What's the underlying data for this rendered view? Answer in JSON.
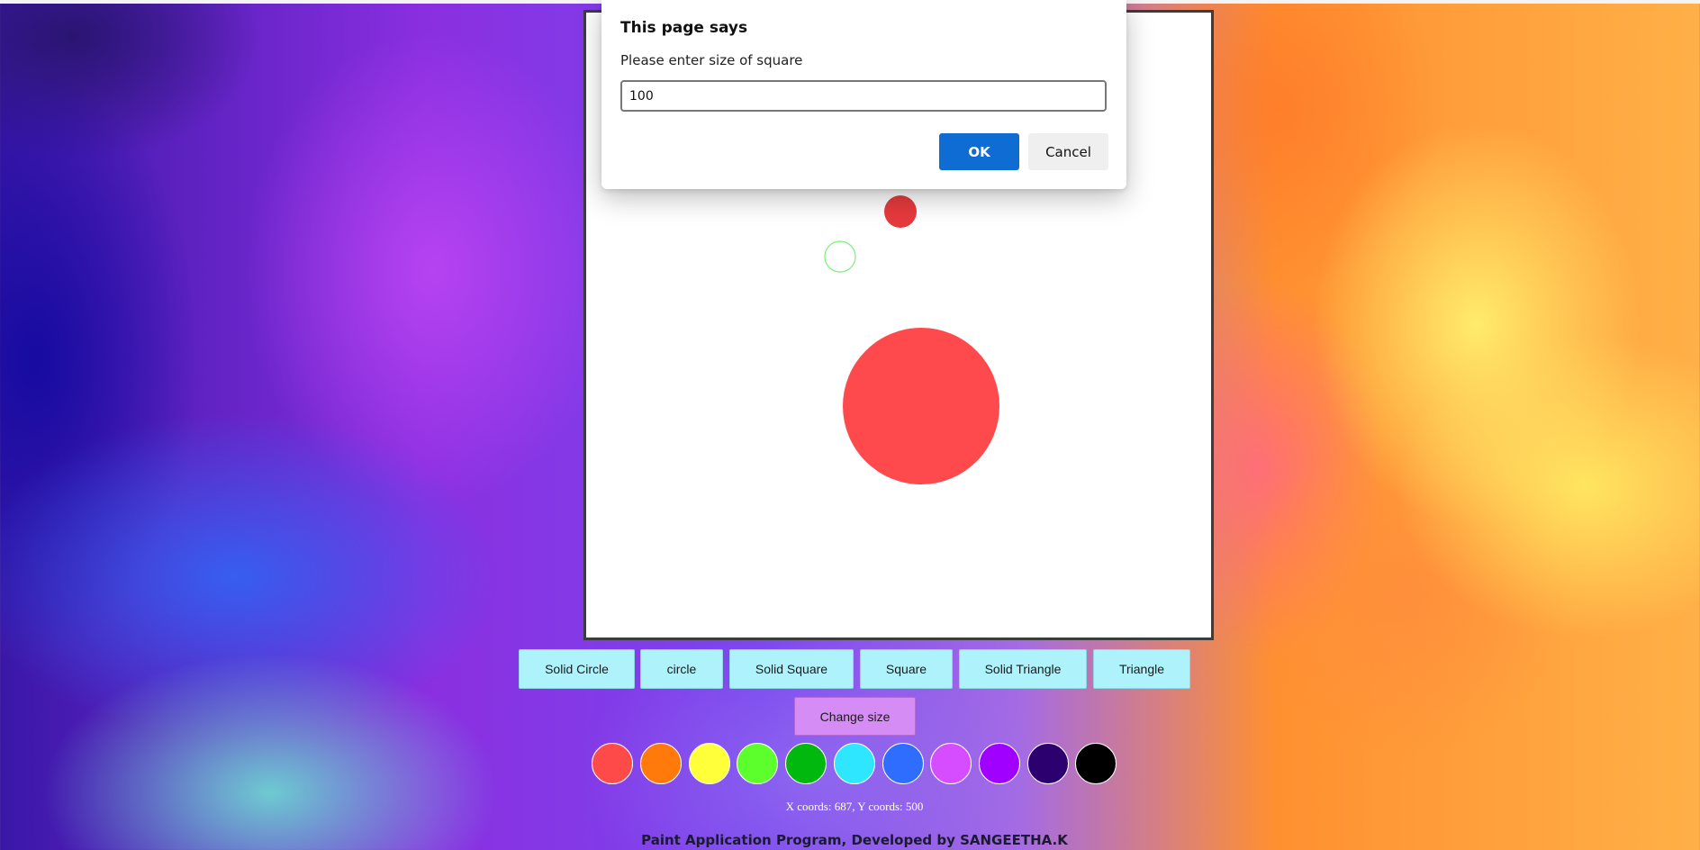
{
  "canvas": {
    "shapes": [
      {
        "type": "solid-circle",
        "color": "#ff4a4d"
      },
      {
        "type": "solid-circle",
        "color": "#e63a3d"
      },
      {
        "type": "circle",
        "color": "#7cf07c"
      }
    ]
  },
  "toolbar": {
    "buttons": [
      {
        "label": "Solid Circle"
      },
      {
        "label": "circle"
      },
      {
        "label": "Solid Square"
      },
      {
        "label": "Square"
      },
      {
        "label": "Solid Triangle"
      },
      {
        "label": "Triangle"
      }
    ],
    "change_size_label": "Change size"
  },
  "palette": {
    "colors": [
      "#ff4a4a",
      "#ff7a0a",
      "#ffff3a",
      "#5cff2c",
      "#00b80e",
      "#2ee6ff",
      "#2f6dff",
      "#d64dff",
      "#a000ff",
      "#2d006f",
      "#000000"
    ]
  },
  "status": {
    "coords": "X coords: 687, Y coords: 500"
  },
  "footer": {
    "text": "Paint Application Program, Developed by SANGEETHA.K"
  },
  "dialog": {
    "title": "This page says",
    "message": "Please enter size of square",
    "input_value": "100",
    "ok_label": "OK",
    "cancel_label": "Cancel"
  }
}
